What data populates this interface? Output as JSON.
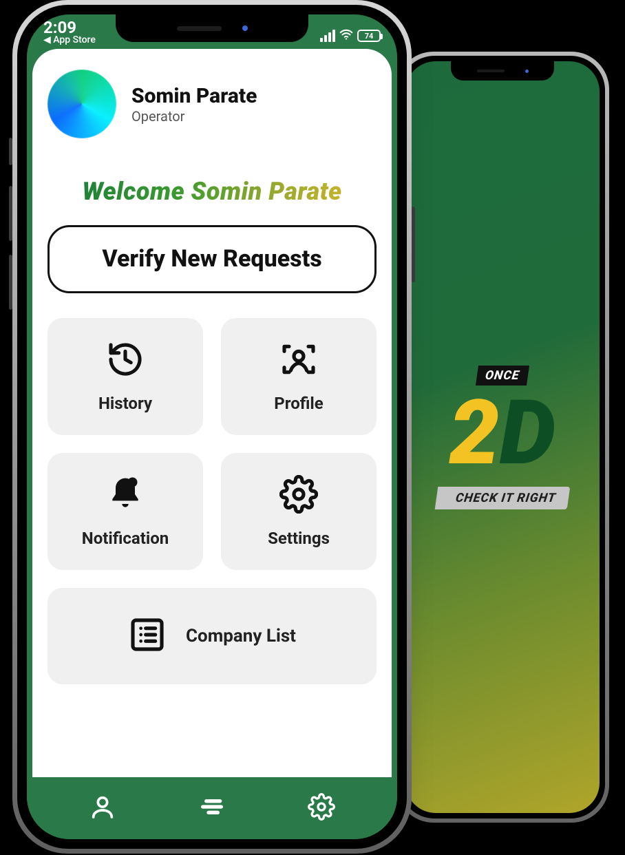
{
  "status": {
    "time": "2:09",
    "back_link": "App Store",
    "battery": "74"
  },
  "user": {
    "name": "Somin Parate",
    "role": "Operator"
  },
  "welcome_text": "Welcome Somin Parate",
  "verify_button": "Verify New Requests",
  "tiles": {
    "history": "History",
    "profile": "Profile",
    "notification": "Notification",
    "settings": "Settings",
    "company_list": "Company List"
  },
  "splash": {
    "top_tag": "ONCE",
    "logo_first": "2",
    "logo_second": "D",
    "bottom_tag": "CHECK IT RIGHT"
  },
  "colors": {
    "brand_green": "#2a7a49"
  }
}
